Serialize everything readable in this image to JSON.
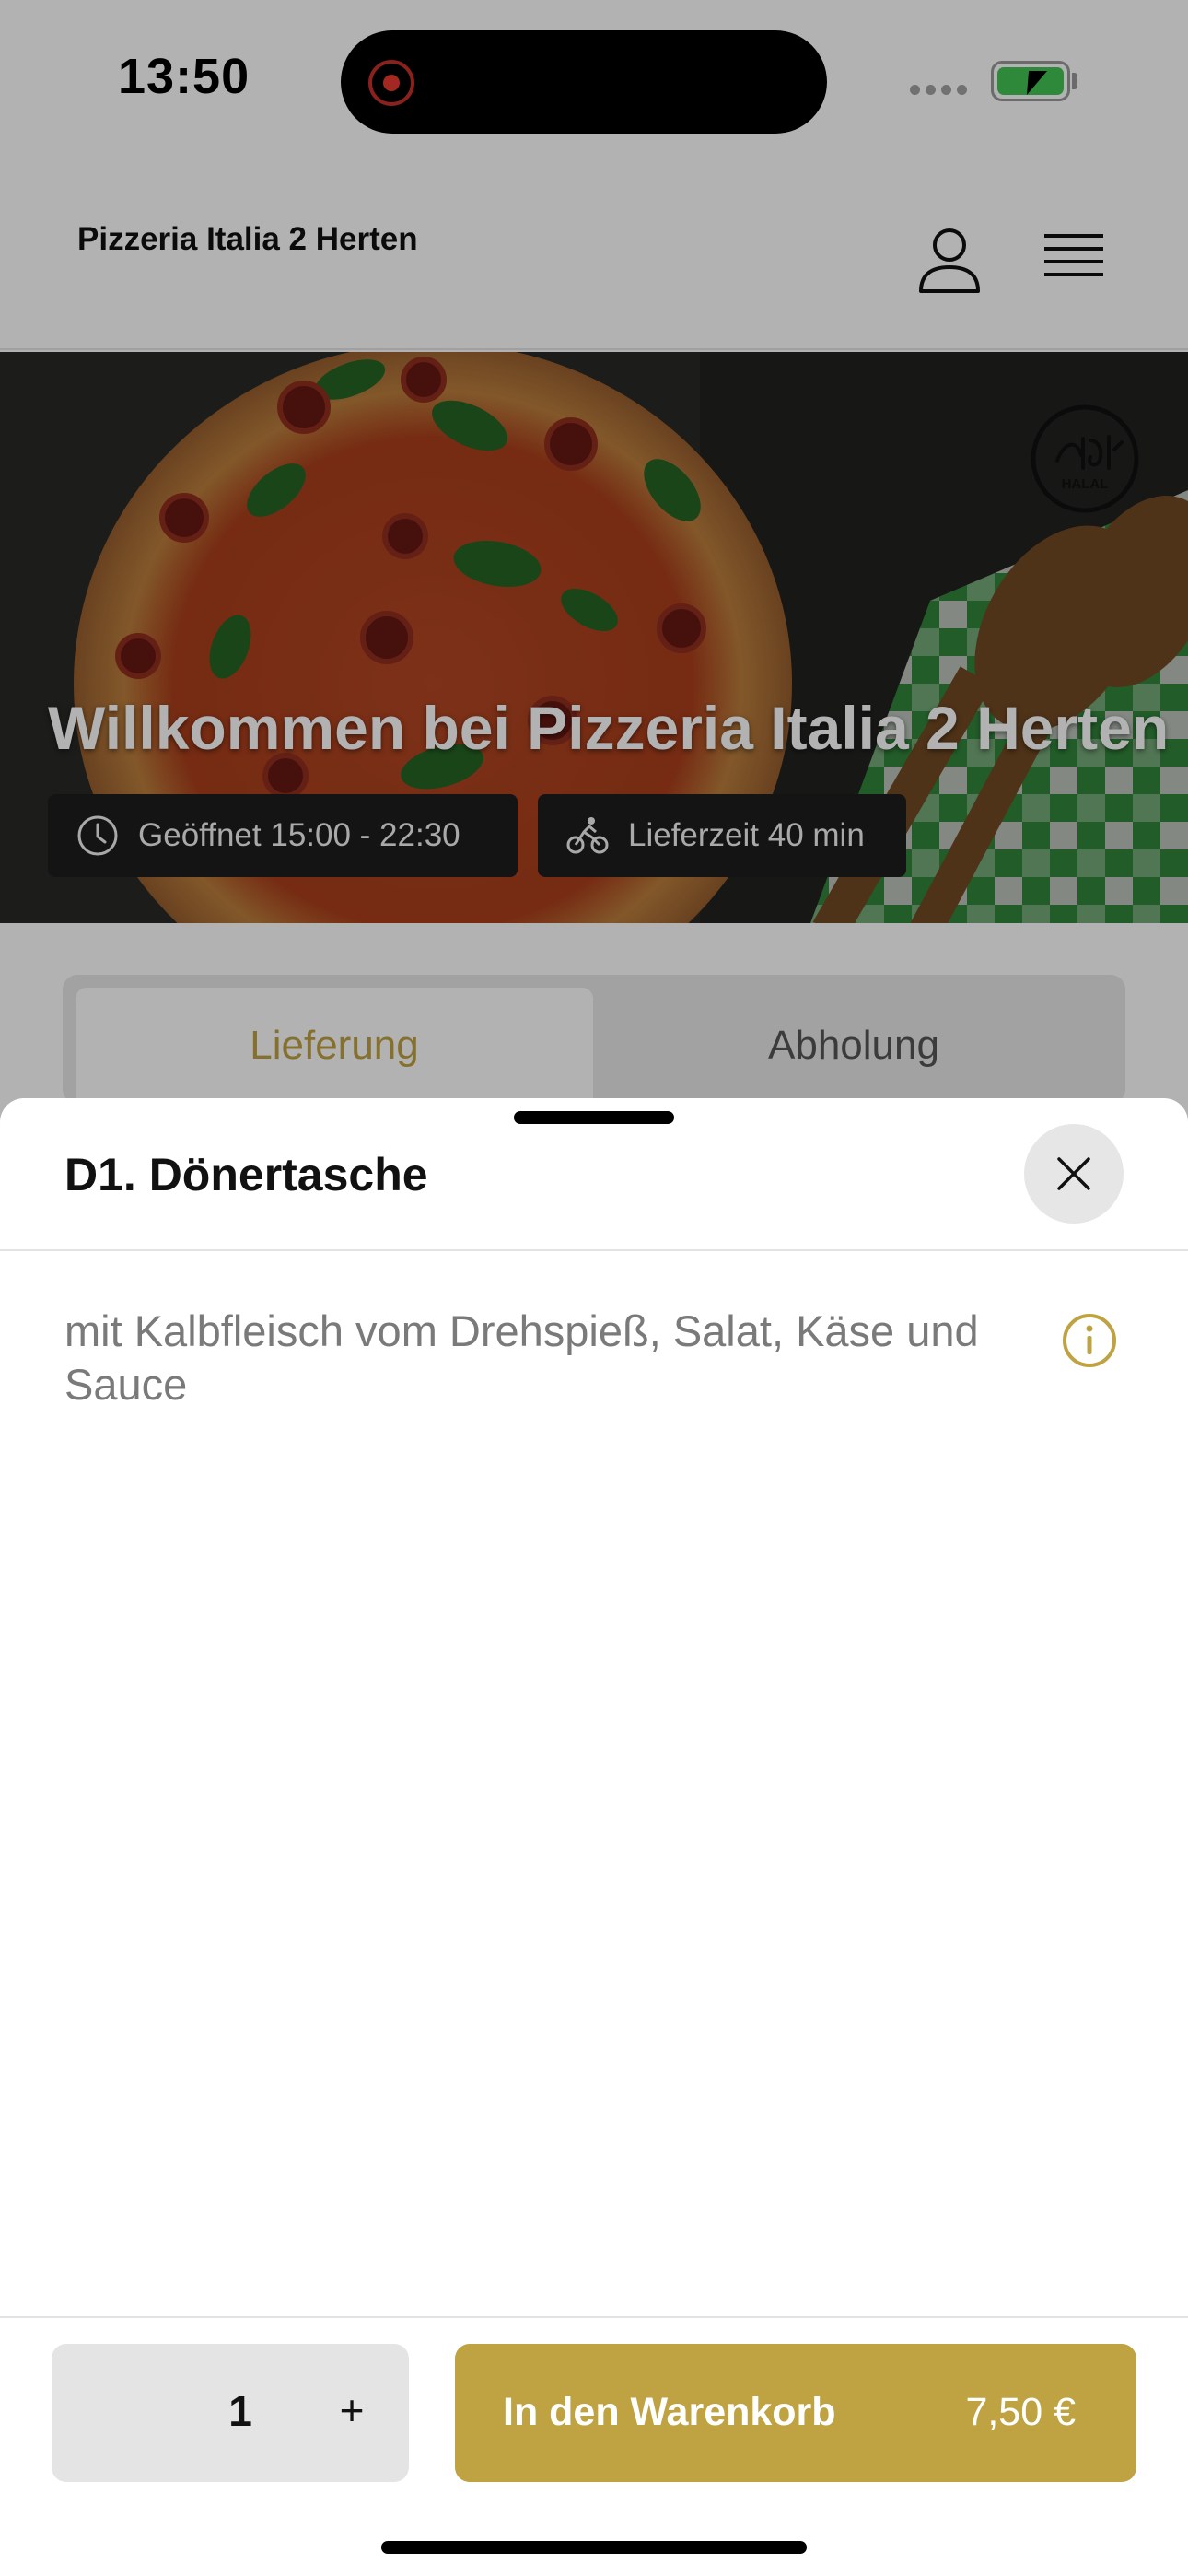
{
  "status_bar": {
    "time": "13:50"
  },
  "header": {
    "brand": "Pizzeria Italia 2 Herten"
  },
  "hero": {
    "title": "Willkommen bei Pizzeria Italia 2 Herten",
    "open_hours": "Geöffnet 15:00 - 22:30",
    "delivery_time": "Lieferzeit 40 min",
    "halal_badge": "HALAL"
  },
  "mode_toggle": {
    "delivery": "Lieferung",
    "pickup": "Abholung",
    "selected": "delivery"
  },
  "product_sheet": {
    "title": "D1. Dönertasche",
    "description": "mit Kalbfleisch vom Drehspieß, Salat, Käse und Sauce",
    "quantity": "1",
    "plus_label": "+",
    "add_to_cart_label": "In den Warenkorb",
    "price": "7,50 €"
  },
  "colors": {
    "accent": "#bfa241",
    "overlay": "rgba(0,0,0,0.30)",
    "battery": "#43c653",
    "recording": "#e83a30"
  },
  "icons": [
    "recording-icon",
    "battery-icon",
    "user-icon",
    "menu-icon",
    "clock-icon",
    "bicycle-icon",
    "halal-logo",
    "close-icon",
    "info-icon"
  ]
}
